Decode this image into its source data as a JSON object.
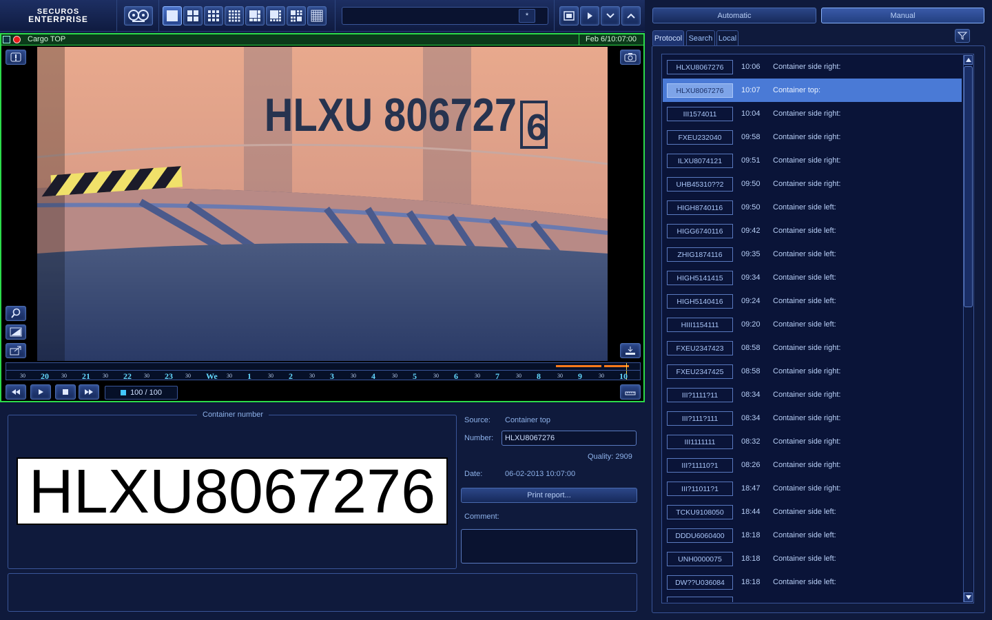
{
  "app": {
    "logo_line1": "SECUROS",
    "logo_line2": "ENTERPRISE"
  },
  "toolbar": {
    "search_star": "*"
  },
  "viewer": {
    "camera_name": "Cargo TOP",
    "timestamp": "Feb 6/10:07:00",
    "container_text": "HLXU 806727",
    "check_digit": "6",
    "counter": "100 / 100",
    "timeline_labels": [
      "30",
      "20",
      "30",
      "21",
      "30",
      "22",
      "30",
      "23",
      "30",
      "We",
      "30",
      "1",
      "30",
      "2",
      "30",
      "3",
      "30",
      "4",
      "30",
      "5",
      "30",
      "6",
      "30",
      "7",
      "30",
      "8",
      "30",
      "9",
      "30",
      "10"
    ]
  },
  "details": {
    "group_title": "Container number",
    "plate": "HLXU8067276",
    "source_label": "Source:",
    "source_value": "Container top",
    "number_label": "Number:",
    "number_value": "HLXU8067276",
    "quality": "Quality: 2909",
    "date_label": "Date:",
    "date_value": "06-02-2013 10:07:00",
    "print_button": "Print report...",
    "comment_label": "Comment:"
  },
  "right_panel": {
    "mode_automatic": "Automatic",
    "mode_manual": "Manual",
    "tabs": [
      "Protocol",
      "Search",
      "Local"
    ],
    "active_tab": "Protocol",
    "selected_index": 1,
    "rows": [
      {
        "number": "HLXU8067276",
        "time": "10:06",
        "desc": "Container side right:"
      },
      {
        "number": "HLXU8067276",
        "time": "10:07",
        "desc": "Container top:"
      },
      {
        "number": "III1574011",
        "time": "10:04",
        "desc": "Container side right:"
      },
      {
        "number": "FXEU232040",
        "time": "09:58",
        "desc": "Container side right:"
      },
      {
        "number": "ILXU8074121",
        "time": "09:51",
        "desc": "Container side right:"
      },
      {
        "number": "UHB45310??2",
        "time": "09:50",
        "desc": "Container side right:"
      },
      {
        "number": "HIGH8740116",
        "time": "09:50",
        "desc": "Container side left:"
      },
      {
        "number": "HIGG6740116",
        "time": "09:42",
        "desc": "Container side left:"
      },
      {
        "number": "ZHIG1874116",
        "time": "09:35",
        "desc": "Container side left:"
      },
      {
        "number": "HIGH5141415",
        "time": "09:34",
        "desc": "Container side left:"
      },
      {
        "number": "HIGH5140416",
        "time": "09:24",
        "desc": "Container side left:"
      },
      {
        "number": "HIII1154111",
        "time": "09:20",
        "desc": "Container side left:"
      },
      {
        "number": "FXEU2347423",
        "time": "08:58",
        "desc": "Container side right:"
      },
      {
        "number": "FXEU2347425",
        "time": "08:58",
        "desc": "Container side right:"
      },
      {
        "number": "III?1111?11",
        "time": "08:34",
        "desc": "Container side right:"
      },
      {
        "number": "III?111?111",
        "time": "08:34",
        "desc": "Container side right:"
      },
      {
        "number": "III1111111",
        "time": "08:32",
        "desc": "Container side right:"
      },
      {
        "number": "III?11110?1",
        "time": "08:26",
        "desc": "Container side right:"
      },
      {
        "number": "III?11011?1",
        "time": "18:47",
        "desc": "Container side right:"
      },
      {
        "number": "TCKU9108050",
        "time": "18:44",
        "desc": "Container side left:"
      },
      {
        "number": "DDDU6060400",
        "time": "18:18",
        "desc": "Container side left:"
      },
      {
        "number": "UNH0000075",
        "time": "18:18",
        "desc": "Container side left:"
      },
      {
        "number": "DW??U036084",
        "time": "18:18",
        "desc": "Container side left:"
      }
    ]
  },
  "colors": {
    "accent_green": "#2cdc4a",
    "selected_row": "#4a7ad6",
    "background": "#0f1a3c"
  }
}
